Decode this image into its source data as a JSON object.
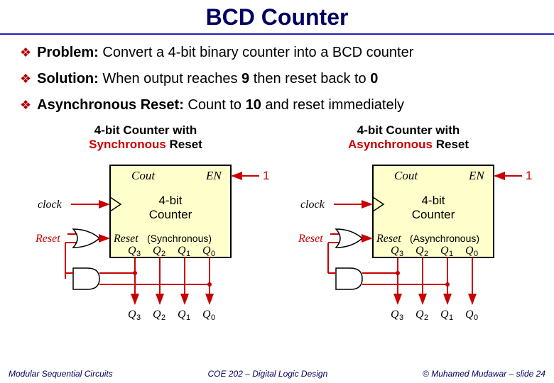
{
  "title": "BCD Counter",
  "bullets": {
    "b1_label": "Problem:",
    "b1_text": " Convert a 4-bit binary counter into a BCD counter",
    "b2_label": "Solution:",
    "b2_text_a": " When output reaches ",
    "b2_nine": "9",
    "b2_text_b": " then reset back to ",
    "b2_zero": "0",
    "b3_label": "Asynchronous Reset:",
    "b3_text_a": " Count to ",
    "b3_ten": "10",
    "b3_text_b": " and reset immediately"
  },
  "diag": {
    "left": {
      "caption_a": "4-bit Counter with",
      "caption_b1": "Synchronous",
      "caption_b2": " Reset",
      "cout": "Cout",
      "en": "EN",
      "one": "1",
      "clock": "clock",
      "reset": "Reset",
      "block1": "4-bit",
      "block2": "Counter",
      "reset_pin": "Reset",
      "reset_type": "(Synchronous)",
      "q3": "Q",
      "q3s": "3",
      "q2": "Q",
      "q2s": "2",
      "q1": "Q",
      "q1s": "1",
      "q0": "Q",
      "q0s": "0"
    },
    "right": {
      "caption_a": "4-bit Counter with",
      "caption_b1": "Asynchronous",
      "caption_b2": " Reset",
      "cout": "Cout",
      "en": "EN",
      "one": "1",
      "clock": "clock",
      "reset": "Reset",
      "block1": "4-bit",
      "block2": "Counter",
      "reset_pin": "Reset",
      "reset_type": "(Asynchronous)",
      "q3": "Q",
      "q3s": "3",
      "q2": "Q",
      "q2s": "2",
      "q1": "Q",
      "q1s": "1",
      "q0": "Q",
      "q0s": "0"
    }
  },
  "footer": {
    "left": "Modular Sequential Circuits",
    "center": "COE 202 – Digital Logic Design",
    "right": "© Muhamed Mudawar – slide 24"
  }
}
